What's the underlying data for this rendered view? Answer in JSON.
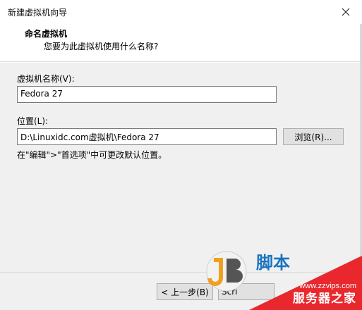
{
  "window": {
    "title": "新建虚拟机向导"
  },
  "header": {
    "title": "命名虚拟机",
    "subtitle": "您要为此虚拟机使用什么名称?"
  },
  "form": {
    "name_label": "虚拟机名称(V):",
    "name_value": "Fedora 27",
    "location_label": "位置(L):",
    "location_value": "D:\\Linuxidc.com虚拟机\\Fedora 27",
    "browse_label": "浏览(R)...",
    "hint": "在\"编辑\">\"首选项\"中可更改默认位置。"
  },
  "footer": {
    "back_label": "< 上一步(B)",
    "next_partial": "Scri"
  },
  "watermark": {
    "url": "www.zzvips.com",
    "brand": "服务器之家",
    "cn_char": "脚本"
  }
}
